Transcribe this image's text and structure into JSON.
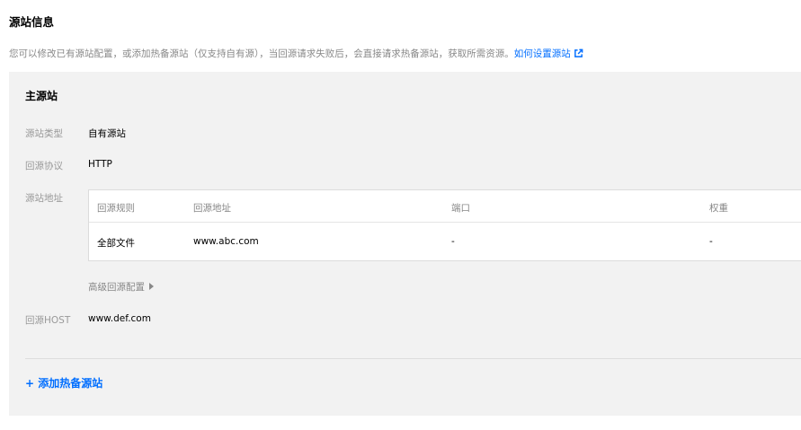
{
  "page": {
    "title": "源站信息",
    "description": "您可以修改已有源站配置，或添加热备源站（仅支持自有源），当回源请求失败后，会直接请求热备源站，获取所需资源。",
    "help_link": "如何设置源站",
    "help_icon": "external-link-icon",
    "accent_color": "#006eff"
  },
  "primary": {
    "title": "主源站",
    "type_label": "源站类型",
    "type_value": "自有源站",
    "protocol_label": "回源协议",
    "protocol_value": "HTTP",
    "address_label": "源站地址",
    "table": {
      "columns": [
        "回源规则",
        "回源地址",
        "端口",
        "权重"
      ],
      "rows": [
        [
          "全部文件",
          "www.abc.com",
          "-",
          "-"
        ]
      ]
    },
    "advanced_label": "高级回源配置",
    "host_label": "回源HOST",
    "host_value": "www.def.com"
  },
  "add_backup": "+ 添加热备源站"
}
